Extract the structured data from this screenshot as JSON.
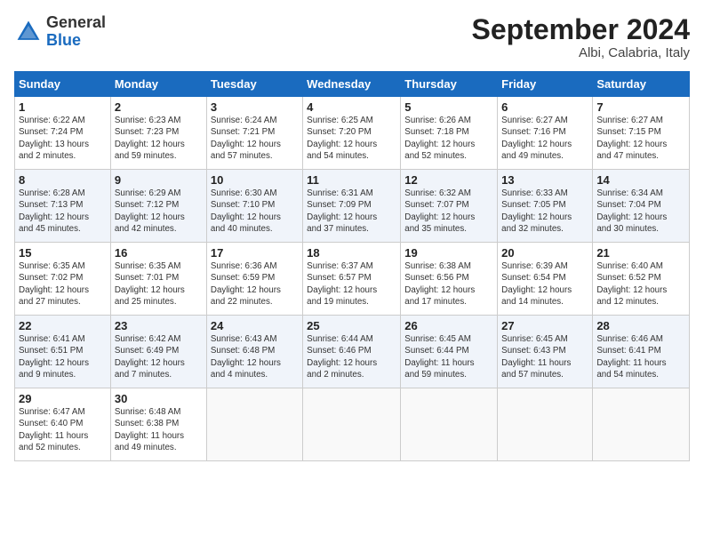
{
  "header": {
    "logo_general": "General",
    "logo_blue": "Blue",
    "month_title": "September 2024",
    "location": "Albi, Calabria, Italy"
  },
  "weekdays": [
    "Sunday",
    "Monday",
    "Tuesday",
    "Wednesday",
    "Thursday",
    "Friday",
    "Saturday"
  ],
  "weeks": [
    [
      {
        "day": "1",
        "info": "Sunrise: 6:22 AM\nSunset: 7:24 PM\nDaylight: 13 hours\nand 2 minutes."
      },
      {
        "day": "2",
        "info": "Sunrise: 6:23 AM\nSunset: 7:23 PM\nDaylight: 12 hours\nand 59 minutes."
      },
      {
        "day": "3",
        "info": "Sunrise: 6:24 AM\nSunset: 7:21 PM\nDaylight: 12 hours\nand 57 minutes."
      },
      {
        "day": "4",
        "info": "Sunrise: 6:25 AM\nSunset: 7:20 PM\nDaylight: 12 hours\nand 54 minutes."
      },
      {
        "day": "5",
        "info": "Sunrise: 6:26 AM\nSunset: 7:18 PM\nDaylight: 12 hours\nand 52 minutes."
      },
      {
        "day": "6",
        "info": "Sunrise: 6:27 AM\nSunset: 7:16 PM\nDaylight: 12 hours\nand 49 minutes."
      },
      {
        "day": "7",
        "info": "Sunrise: 6:27 AM\nSunset: 7:15 PM\nDaylight: 12 hours\nand 47 minutes."
      }
    ],
    [
      {
        "day": "8",
        "info": "Sunrise: 6:28 AM\nSunset: 7:13 PM\nDaylight: 12 hours\nand 45 minutes."
      },
      {
        "day": "9",
        "info": "Sunrise: 6:29 AM\nSunset: 7:12 PM\nDaylight: 12 hours\nand 42 minutes."
      },
      {
        "day": "10",
        "info": "Sunrise: 6:30 AM\nSunset: 7:10 PM\nDaylight: 12 hours\nand 40 minutes."
      },
      {
        "day": "11",
        "info": "Sunrise: 6:31 AM\nSunset: 7:09 PM\nDaylight: 12 hours\nand 37 minutes."
      },
      {
        "day": "12",
        "info": "Sunrise: 6:32 AM\nSunset: 7:07 PM\nDaylight: 12 hours\nand 35 minutes."
      },
      {
        "day": "13",
        "info": "Sunrise: 6:33 AM\nSunset: 7:05 PM\nDaylight: 12 hours\nand 32 minutes."
      },
      {
        "day": "14",
        "info": "Sunrise: 6:34 AM\nSunset: 7:04 PM\nDaylight: 12 hours\nand 30 minutes."
      }
    ],
    [
      {
        "day": "15",
        "info": "Sunrise: 6:35 AM\nSunset: 7:02 PM\nDaylight: 12 hours\nand 27 minutes."
      },
      {
        "day": "16",
        "info": "Sunrise: 6:35 AM\nSunset: 7:01 PM\nDaylight: 12 hours\nand 25 minutes."
      },
      {
        "day": "17",
        "info": "Sunrise: 6:36 AM\nSunset: 6:59 PM\nDaylight: 12 hours\nand 22 minutes."
      },
      {
        "day": "18",
        "info": "Sunrise: 6:37 AM\nSunset: 6:57 PM\nDaylight: 12 hours\nand 19 minutes."
      },
      {
        "day": "19",
        "info": "Sunrise: 6:38 AM\nSunset: 6:56 PM\nDaylight: 12 hours\nand 17 minutes."
      },
      {
        "day": "20",
        "info": "Sunrise: 6:39 AM\nSunset: 6:54 PM\nDaylight: 12 hours\nand 14 minutes."
      },
      {
        "day": "21",
        "info": "Sunrise: 6:40 AM\nSunset: 6:52 PM\nDaylight: 12 hours\nand 12 minutes."
      }
    ],
    [
      {
        "day": "22",
        "info": "Sunrise: 6:41 AM\nSunset: 6:51 PM\nDaylight: 12 hours\nand 9 minutes."
      },
      {
        "day": "23",
        "info": "Sunrise: 6:42 AM\nSunset: 6:49 PM\nDaylight: 12 hours\nand 7 minutes."
      },
      {
        "day": "24",
        "info": "Sunrise: 6:43 AM\nSunset: 6:48 PM\nDaylight: 12 hours\nand 4 minutes."
      },
      {
        "day": "25",
        "info": "Sunrise: 6:44 AM\nSunset: 6:46 PM\nDaylight: 12 hours\nand 2 minutes."
      },
      {
        "day": "26",
        "info": "Sunrise: 6:45 AM\nSunset: 6:44 PM\nDaylight: 11 hours\nand 59 minutes."
      },
      {
        "day": "27",
        "info": "Sunrise: 6:45 AM\nSunset: 6:43 PM\nDaylight: 11 hours\nand 57 minutes."
      },
      {
        "day": "28",
        "info": "Sunrise: 6:46 AM\nSunset: 6:41 PM\nDaylight: 11 hours\nand 54 minutes."
      }
    ],
    [
      {
        "day": "29",
        "info": "Sunrise: 6:47 AM\nSunset: 6:40 PM\nDaylight: 11 hours\nand 52 minutes."
      },
      {
        "day": "30",
        "info": "Sunrise: 6:48 AM\nSunset: 6:38 PM\nDaylight: 11 hours\nand 49 minutes."
      },
      {
        "day": "",
        "info": ""
      },
      {
        "day": "",
        "info": ""
      },
      {
        "day": "",
        "info": ""
      },
      {
        "day": "",
        "info": ""
      },
      {
        "day": "",
        "info": ""
      }
    ]
  ]
}
